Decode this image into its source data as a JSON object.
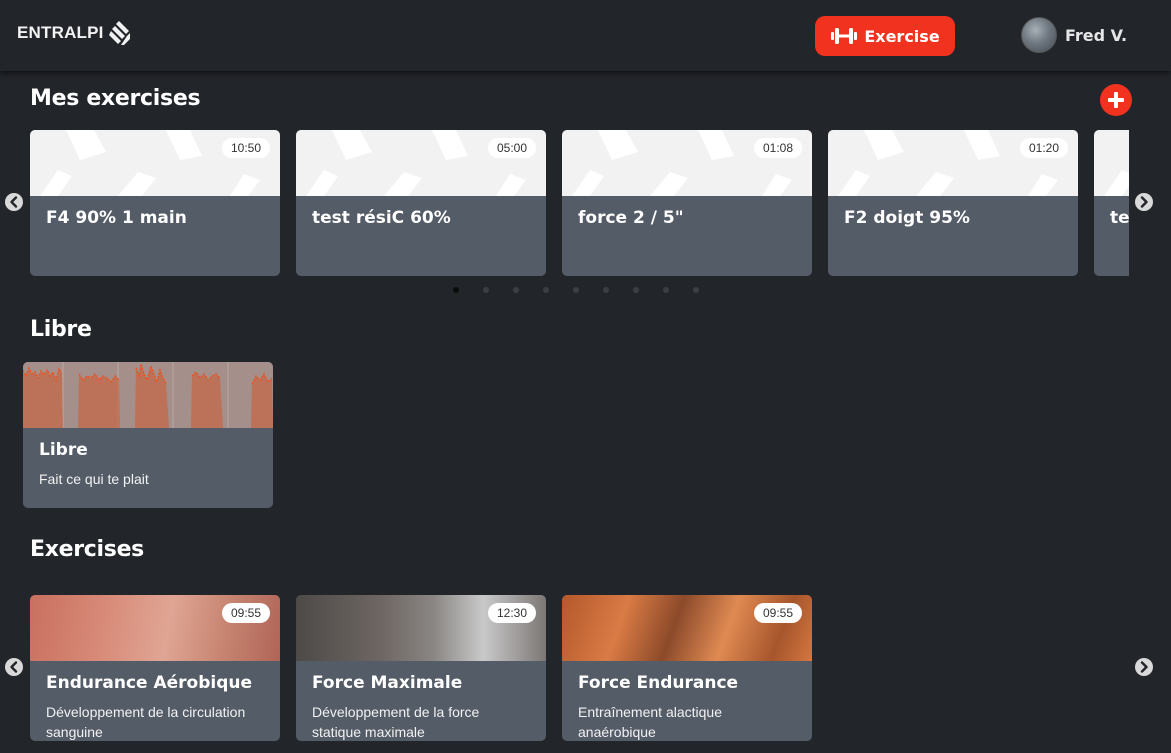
{
  "header": {
    "logo_text": "ENTRALPI",
    "exercise_button": "Exercise",
    "user_name": "Fred V."
  },
  "my_exercises": {
    "title": "Mes exercises",
    "cards": [
      {
        "time": "10:50",
        "title": "F4 90% 1 main"
      },
      {
        "time": "05:00",
        "title": "test résiC 60%"
      },
      {
        "time": "01:08",
        "title": "force 2 / 5\""
      },
      {
        "time": "01:20",
        "title": "F2 doigt 95%"
      },
      {
        "time": "",
        "title": "tes"
      }
    ],
    "page_count": 9,
    "active_page": 1
  },
  "libre": {
    "title": "Libre",
    "card": {
      "title": "Libre",
      "description": "Fait ce qui te plait"
    }
  },
  "exercises": {
    "title": "Exercises",
    "cards": [
      {
        "time": "09:55",
        "title": "Endurance Aérobique",
        "description": "Développement de la circulation sanguine"
      },
      {
        "time": "12:30",
        "title": "Force Maximale",
        "description": "Développement de la force statique maximale"
      },
      {
        "time": "09:55",
        "title": "Force Endurance",
        "description": "Entraînement alactique anaérobique"
      }
    ]
  },
  "colors": {
    "accent": "#f1321f",
    "background": "#22252a",
    "card": "#545c67"
  },
  "icons": {
    "add": "plus-icon",
    "exercise": "dumbbell-icon",
    "prev": "chevron-left-icon",
    "next": "chevron-right-icon"
  }
}
